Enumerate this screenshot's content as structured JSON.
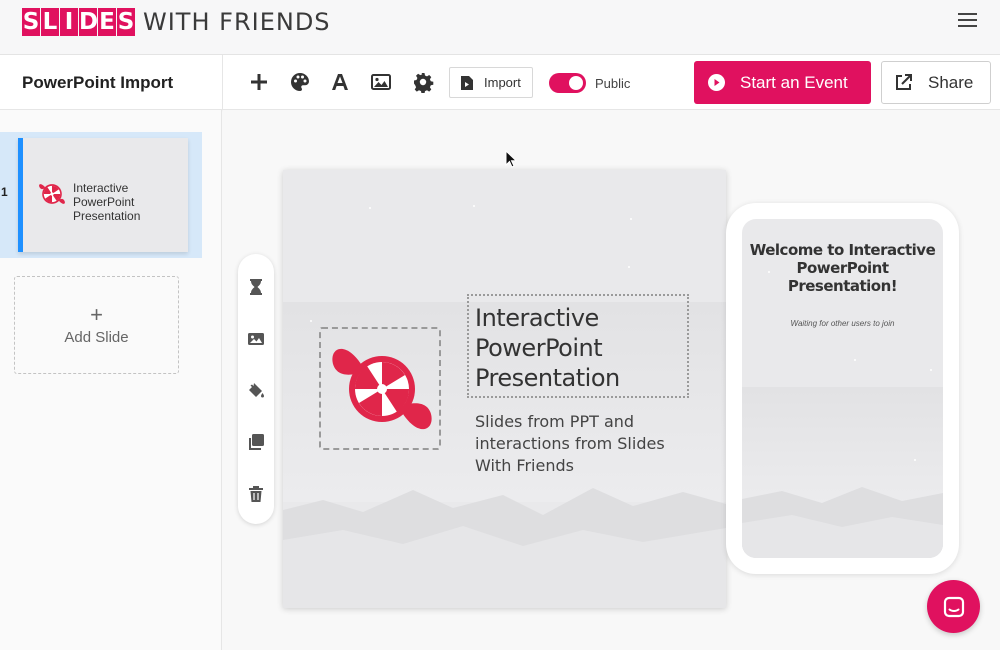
{
  "brand": {
    "logo_letters": [
      "S",
      "L",
      "I",
      "D",
      "E",
      "S"
    ],
    "logo_rest": "WITH FRIENDS",
    "accent_color": "#e0115f"
  },
  "toolbar": {
    "deck_title": "PowerPoint Import",
    "tools": [
      "plus-icon",
      "palette-icon",
      "text-icon",
      "image-icon",
      "gear-icon"
    ],
    "import_label": "Import",
    "public_label": "Public",
    "public_enabled": true,
    "start_event_label": "Start an Event",
    "share_label": "Share"
  },
  "sidebar": {
    "slides": [
      {
        "number": "1",
        "title": "Interactive PowerPoint Presentation"
      }
    ],
    "add_slide_label": "Add Slide"
  },
  "side_tools": [
    "hourglass-icon",
    "image-icon",
    "paint-bucket-icon",
    "copy-icon",
    "trash-icon"
  ],
  "slide": {
    "title": "Interactive PowerPoint Presentation",
    "subtitle": "Slides from PPT and interactions from Slides With Friends"
  },
  "phone_preview": {
    "welcome": "Welcome to Interactive PowerPoint Presentation!",
    "waiting": "Waiting for other users to join"
  }
}
